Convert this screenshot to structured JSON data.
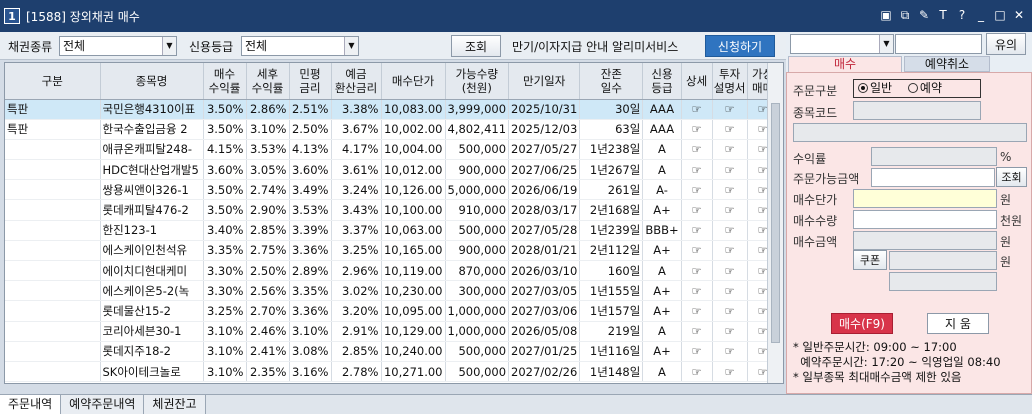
{
  "window": {
    "number": "1",
    "title": "[1588] 장외채권 매수"
  },
  "filter": {
    "bond_type_label": "채권종류",
    "bond_type_value": "전체",
    "grade_label": "신용등급",
    "grade_value": "전체",
    "search_button": "조회",
    "notice_text": "만기/이자지급 안내 알리미서비스",
    "apply_button": "신청하기"
  },
  "table": {
    "headers": [
      "구분",
      "종목명",
      "매수\n수익률",
      "세후\n수익률",
      "민평\n금리",
      "예금\n환산금리",
      "매수단가",
      "가능수량\n(천원)",
      "만기일자",
      "잔존\n일수",
      "신용\n등급",
      "상세",
      "투자\n설명서",
      "가상\n매매"
    ],
    "rows": [
      [
        "특판",
        "국민은행4310이표",
        "3.50%",
        "2.86%",
        "2.51%",
        "3.38%",
        "10,083.00",
        "3,999,000",
        "2025/10/31",
        "30일",
        "AAA"
      ],
      [
        "특판",
        "한국수출입금융 2",
        "3.50%",
        "3.10%",
        "2.50%",
        "3.67%",
        "10,002.00",
        "4,802,411",
        "2025/12/03",
        "63일",
        "AAA"
      ],
      [
        "",
        "애큐온캐피탈248-",
        "4.15%",
        "3.53%",
        "4.13%",
        "4.17%",
        "10,004.00",
        "500,000",
        "2027/05/27",
        "1년238일",
        "A"
      ],
      [
        "",
        "HDC현대산업개발5",
        "3.60%",
        "3.05%",
        "3.60%",
        "3.61%",
        "10,012.00",
        "900,000",
        "2027/06/25",
        "1년267일",
        "A"
      ],
      [
        "",
        "쌍용씨앤이326-1",
        "3.50%",
        "2.74%",
        "3.49%",
        "3.24%",
        "10,126.00",
        "5,000,000",
        "2026/06/19",
        "261일",
        "A-"
      ],
      [
        "",
        "롯데캐피탈476-2",
        "3.50%",
        "2.90%",
        "3.53%",
        "3.43%",
        "10,100.00",
        "910,000",
        "2028/03/17",
        "2년168일",
        "A+"
      ],
      [
        "",
        "한진123-1",
        "3.40%",
        "2.85%",
        "3.39%",
        "3.37%",
        "10,063.00",
        "500,000",
        "2027/05/28",
        "1년239일",
        "BBB+"
      ],
      [
        "",
        "에스케이인천석유",
        "3.35%",
        "2.75%",
        "3.36%",
        "3.25%",
        "10,165.00",
        "900,000",
        "2028/01/21",
        "2년112일",
        "A+"
      ],
      [
        "",
        "에이치디현대케미",
        "3.30%",
        "2.50%",
        "2.89%",
        "2.96%",
        "10,119.00",
        "870,000",
        "2026/03/10",
        "160일",
        "A"
      ],
      [
        "",
        "에스케이온5-2(녹",
        "3.30%",
        "2.56%",
        "3.35%",
        "3.02%",
        "10,230.00",
        "300,000",
        "2027/03/05",
        "1년155일",
        "A+"
      ],
      [
        "",
        "롯데물산15-2",
        "3.25%",
        "2.70%",
        "3.36%",
        "3.20%",
        "10,095.00",
        "1,000,000",
        "2027/03/06",
        "1년157일",
        "A+"
      ],
      [
        "",
        "코리아세븐30-1",
        "3.10%",
        "2.46%",
        "3.10%",
        "2.91%",
        "10,129.00",
        "1,000,000",
        "2026/05/08",
        "219일",
        "A"
      ],
      [
        "",
        "롯데지주18-2",
        "3.10%",
        "2.41%",
        "3.08%",
        "2.85%",
        "10,240.00",
        "500,000",
        "2027/01/25",
        "1년116일",
        "A+"
      ],
      [
        "",
        "SK아이테크놀로",
        "3.10%",
        "2.35%",
        "3.16%",
        "2.78%",
        "10,271.00",
        "500,000",
        "2027/02/26",
        "1년148일",
        "A"
      ]
    ]
  },
  "bottom_tabs": [
    "주문내역",
    "예약주문내역",
    "체권잔고"
  ],
  "right_panel": {
    "search_button": "유의",
    "tabs": [
      "매수",
      "예약취소"
    ],
    "order_type_label": "주문구분",
    "order_type_options": [
      "일반",
      "예약"
    ],
    "code_label": "종목코드",
    "yield_label": "수익률",
    "yield_unit": "%",
    "available_label": "주문가능금액",
    "available_button": "조회",
    "price_label": "매수단가",
    "price_unit": "원",
    "qty_label": "매수수량",
    "qty_unit": "천원",
    "amount_label": "매수금액",
    "amount_unit": "원",
    "coupon_button": "쿠폰",
    "coupon_unit": "원",
    "buy_button": "매수(F9)",
    "clear_button": "지 움",
    "notes": [
      "* 일반주문시간: 09:00 ~ 17:00",
      "  예약주문시간: 17:20 ~ 익영업일 08:40",
      "* 일부종목 최대매수금액 제한 있음"
    ]
  },
  "colors": {
    "title_bg": "#1e3f6e",
    "selected_row": "#cfe8f7",
    "buy_button": "#d8344a",
    "apply_button": "#2f74c0",
    "order_panel": "#fbe6e6"
  }
}
